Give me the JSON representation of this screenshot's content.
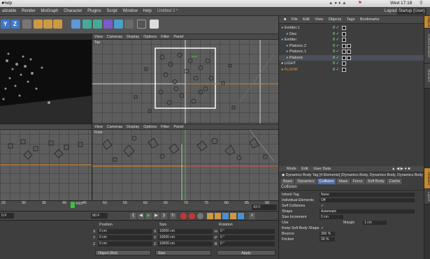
{
  "mac_menubar": {
    "app_menu": "Help",
    "clock": "Wed 17:18"
  },
  "window": {
    "title": "Untitled 2 *"
  },
  "app_menu": {
    "items": [
      "alizable",
      "Render",
      "MoGraph",
      "Character",
      "Plugins",
      "Script",
      "Window",
      "Help"
    ]
  },
  "layout": {
    "label": "Layout",
    "value": "Startup (User)"
  },
  "toolbar": {
    "axis_labels": [
      "Y",
      "Z"
    ]
  },
  "viewports": {
    "menu": [
      "View",
      "Cameras",
      "Display",
      "Options",
      "Filter",
      "Panel"
    ],
    "top_label": "Top",
    "front_label": "Front"
  },
  "object_manager": {
    "menu": [
      "File",
      "Edit",
      "View",
      "Objects",
      "Tags",
      "Bookmarks"
    ],
    "objects": [
      {
        "name": "Emitter.1",
        "indent": 0,
        "status": "0 ✓"
      },
      {
        "name": "Disc",
        "indent": 1,
        "status": "0 ✓"
      },
      {
        "name": "Emitter",
        "indent": 0,
        "status": "0 ✓"
      },
      {
        "name": "Platonic.2",
        "indent": 1,
        "status": "0 ✓"
      },
      {
        "name": "Platonic.1",
        "indent": 1,
        "status": "0 ✓"
      },
      {
        "name": "Platonic",
        "indent": 1,
        "status": "0 ✓"
      },
      {
        "name": "LIGHT",
        "indent": 0,
        "status": "0 ✓"
      },
      {
        "name": "FLOOR",
        "indent": 0,
        "status": "0 ✓"
      }
    ]
  },
  "attributes": {
    "menu": [
      "Mode",
      "Edit",
      "User Data"
    ],
    "header": "Dynamics Body Tag [4 Elements] (Dynamics Body, Dynamics Body, Dynamics Body",
    "tabs": [
      "Basic",
      "Dynamics",
      "Collision",
      "Mass",
      "Force",
      "Soft Body",
      "Cache"
    ],
    "active_tab": "Collision",
    "section": "Collision",
    "properties": [
      {
        "label": "Inherit Tag",
        "value": "None"
      },
      {
        "label": "Individual Elements",
        "value": "Off"
      },
      {
        "label": "Self Collisions",
        "value": "✓"
      },
      {
        "label": "Shape",
        "value": "Automatic"
      },
      {
        "label": "Size Increment",
        "value": "0 cm"
      },
      {
        "label": "Use",
        "value": ""
      },
      {
        "label": "Margin",
        "value": "1 cm"
      },
      {
        "label": "Keep Soft Body Shape",
        "value": "✓"
      },
      {
        "label": "Bounce",
        "value": "300 %"
      },
      {
        "label": "Friction",
        "value": "30 %"
      }
    ]
  },
  "right_tabs": [
    "Attributes",
    "Layers"
  ],
  "right_tabs_top": [
    "Objects",
    "Content Browser",
    "Structure"
  ],
  "timeline": {
    "ticks": [
      "25",
      "30",
      "35",
      "40",
      "45",
      "50",
      "55",
      "60",
      "65",
      "70",
      "75",
      "80",
      "85",
      "90"
    ],
    "current_frame": "43 F",
    "playhead_label": "43/3",
    "end_frame": "90 F",
    "left_field": "0 F"
  },
  "coordinates": {
    "headers": [
      "Position",
      "Size",
      "Rotation"
    ],
    "rows": [
      {
        "axis": "X",
        "pos": "0 cm",
        "size": "10000 cm",
        "rot_axis": "H",
        "rot": "0 °"
      },
      {
        "axis": "Y",
        "pos": "0 cm",
        "size": "10000 cm",
        "rot_axis": "P",
        "rot": "0 °"
      },
      {
        "axis": "Z",
        "pos": "0 cm",
        "size": "10000 cm",
        "rot_axis": "B",
        "rot": "0 °"
      }
    ],
    "mode_select": "Object (Rel)",
    "size_select": "Size",
    "apply_label": "Apply"
  },
  "colors": {
    "accent": "#4f6fa8",
    "orange_axis": "#e08a2a",
    "green_axis": "#3fbf3f",
    "floor_label": "#e0a040"
  }
}
